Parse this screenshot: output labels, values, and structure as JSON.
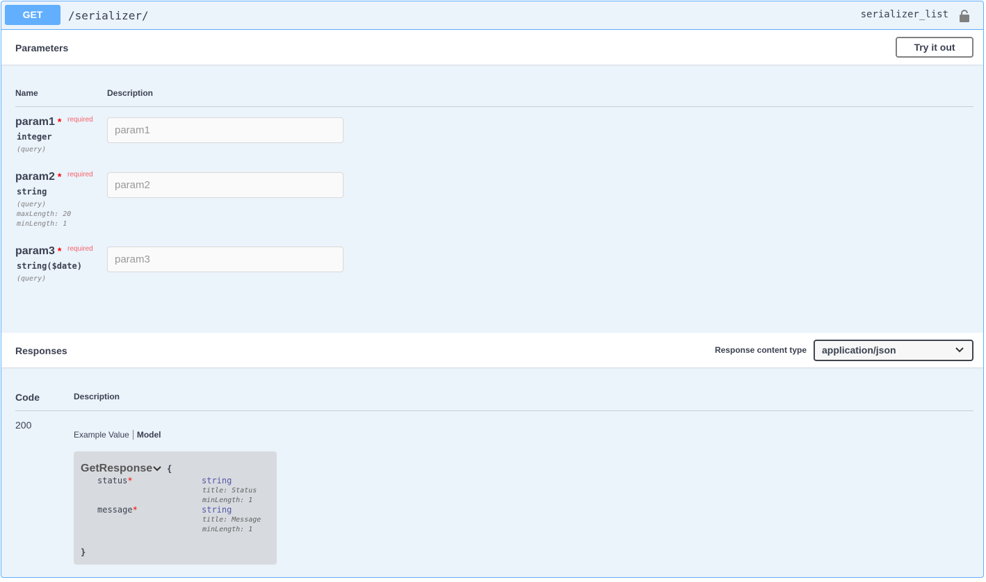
{
  "operation": {
    "method": "GET",
    "path": "/serializer/",
    "operation_id": "serializer_list"
  },
  "parameters": {
    "title": "Parameters",
    "try_it_out_label": "Try it out",
    "col_name": "Name",
    "col_description": "Description",
    "items": [
      {
        "name": "param1",
        "required_label": "required",
        "type": "integer",
        "in": "(query)",
        "constraints": [],
        "placeholder": "param1"
      },
      {
        "name": "param2",
        "required_label": "required",
        "type": "string",
        "in": "(query)",
        "constraints": [
          "maxLength: 20",
          "minLength: 1"
        ],
        "placeholder": "param2"
      },
      {
        "name": "param3",
        "required_label": "required",
        "type": "string($date)",
        "in": "(query)",
        "constraints": [],
        "placeholder": "param3"
      }
    ]
  },
  "responses": {
    "title": "Responses",
    "content_type_label": "Response content type",
    "content_type_value": "application/json",
    "col_code": "Code",
    "col_description": "Description",
    "rows": [
      {
        "code": "200",
        "tab_example": "Example Value",
        "tab_model": "Model",
        "model": {
          "name": "GetResponse",
          "open_brace": "{",
          "close_brace": "}",
          "properties": [
            {
              "name": "status",
              "type": "string",
              "title": "title: Status",
              "min_length": "minLength: 1"
            },
            {
              "name": "message",
              "type": "string",
              "title": "title: Message",
              "min_length": "minLength: 1"
            }
          ]
        }
      }
    ]
  },
  "colors": {
    "get": "#61affe",
    "block_bg": "#ebf3fb",
    "required": "#ff0000"
  }
}
